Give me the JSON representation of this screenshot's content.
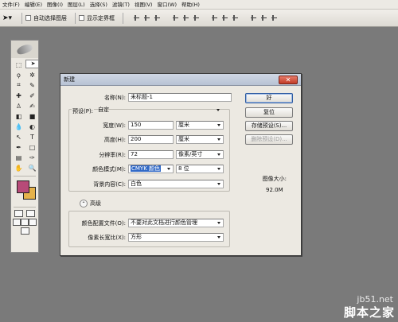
{
  "menubar": {
    "items": [
      "文件(F)",
      "编辑(E)",
      "图像(I)",
      "图层(L)",
      "选择(S)",
      "滤镜(T)",
      "视图(V)",
      "窗口(W)",
      "帮助(H)"
    ]
  },
  "options_bar": {
    "auto_select_label": "自动选择图层",
    "show_bounds_label": "显示定界框"
  },
  "dialog": {
    "title": "新建",
    "name_label": "名称(N):",
    "name_value": "未标题-1",
    "preset_label": "预设(P):",
    "preset_value": "自定",
    "width_label": "宽度(W):",
    "width_value": "150",
    "width_unit": "厘米",
    "height_label": "高度(H):",
    "height_value": "200",
    "height_unit": "厘米",
    "resolution_label": "分辨率(R):",
    "resolution_value": "72",
    "resolution_unit": "像素/英寸",
    "color_mode_label": "颜色模式(M):",
    "color_mode_value": "CMYK 颜色",
    "bit_depth_value": "8 位",
    "background_label": "背景内容(C):",
    "background_value": "白色",
    "advanced_label": "高级",
    "color_profile_label": "颜色配置文件(O):",
    "color_profile_value": "不要对此文档进行颜色管理",
    "pixel_aspect_label": "像素长宽比(X):",
    "pixel_aspect_value": "方形",
    "ok_label": "好",
    "reset_label": "复位",
    "save_preset_label": "存储预设(S)...",
    "delete_preset_label": "删除预设(D)...",
    "image_size_label": "图像大小:",
    "image_size_value": "92.0M"
  },
  "colors": {
    "foreground": "#b74a78",
    "background": "#e6b24a"
  },
  "watermark": {
    "url": "jb51.net",
    "logo": "脚本之家"
  }
}
